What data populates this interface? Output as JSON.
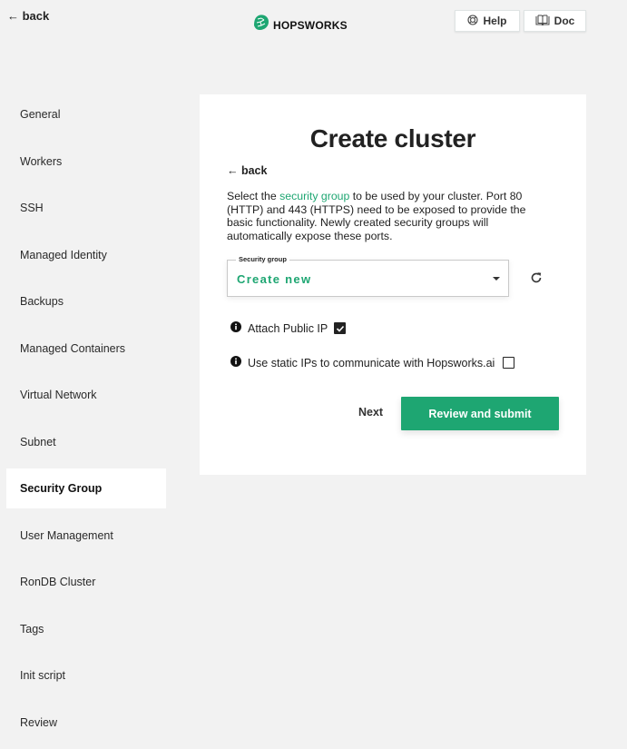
{
  "header": {
    "back_label": "← back",
    "logo_text": "HOPSWORKS",
    "logo_icon": "hop-cone-icon",
    "help_label": "Help",
    "help_icon": "lifebuoy-icon",
    "doc_label": "Doc",
    "doc_icon": "book-icon"
  },
  "sidebar": {
    "items": [
      {
        "label": "General"
      },
      {
        "label": "Workers"
      },
      {
        "label": "SSH"
      },
      {
        "label": "Managed Identity"
      },
      {
        "label": "Backups"
      },
      {
        "label": "Managed Containers"
      },
      {
        "label": "Virtual Network"
      },
      {
        "label": "Subnet"
      },
      {
        "label": "Security Group",
        "active": true
      },
      {
        "label": "User Management"
      },
      {
        "label": "RonDB Cluster"
      },
      {
        "label": "Tags"
      },
      {
        "label": "Init script"
      },
      {
        "label": "Review"
      }
    ]
  },
  "main": {
    "title": "Create cluster",
    "back_label": "← back",
    "description": {
      "before_link": "Select the ",
      "link": "security group",
      "after_link": " to be used by your cluster. Port 80 (HTTP) and 443 (HTTPS) need to be exposed to provide the basic functionality. Newly created security groups will automatically expose these ports."
    },
    "security_group": {
      "label": "Security group",
      "value": "Create new"
    },
    "options": [
      {
        "label": "Attach Public IP",
        "checked": true
      },
      {
        "label": "Use static IPs to communicate with Hopsworks.ai",
        "checked": false
      }
    ],
    "next_label": "Next",
    "submit_label": "Review and submit"
  },
  "colors": {
    "accent": "#1ea672",
    "background": "#f2f2f2",
    "card": "#ffffff"
  }
}
